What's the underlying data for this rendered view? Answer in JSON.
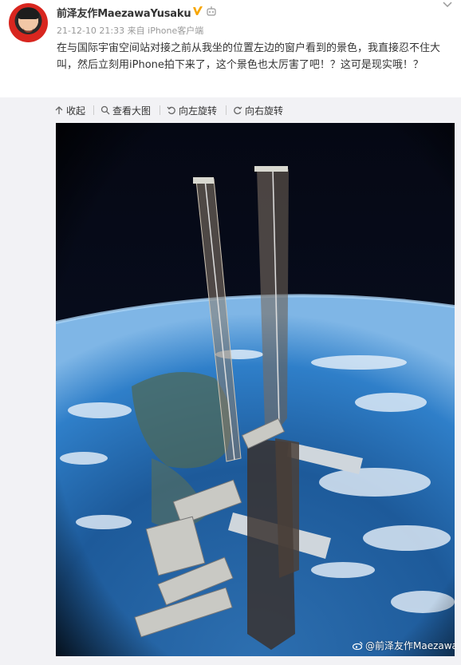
{
  "post": {
    "username": "前泽友作MaezawaYusaku",
    "timestamp": "21-12-10 21:33",
    "source_prefix": "来自",
    "source": "iPhone客户端",
    "text": "在与国际宇宙空间站对接之前从我坐的位置左边的窗户看到的景色，我直接忍不住大叫，然后立刻用iPhone拍下来了，这个景色也太厉害了吧！？这可是现实哦！？"
  },
  "toolbar": {
    "collapse": "收起",
    "view_large": "查看大图",
    "rotate_left": "向左旋转",
    "rotate_right": "向右旋转"
  },
  "photo": {
    "watermark": "@前泽友作MaezawaYusaku"
  },
  "colors": {
    "text": "#333333",
    "meta": "#999999",
    "toolbar_bg": "#f2f2f5",
    "verified": "#f7a600"
  },
  "icons": [
    "more-chevron-icon",
    "verified-badge-icon",
    "robot-badge-icon",
    "collapse-arrow-icon",
    "magnifier-icon",
    "rotate-left-icon",
    "rotate-right-icon",
    "weibo-logo-icon"
  ]
}
